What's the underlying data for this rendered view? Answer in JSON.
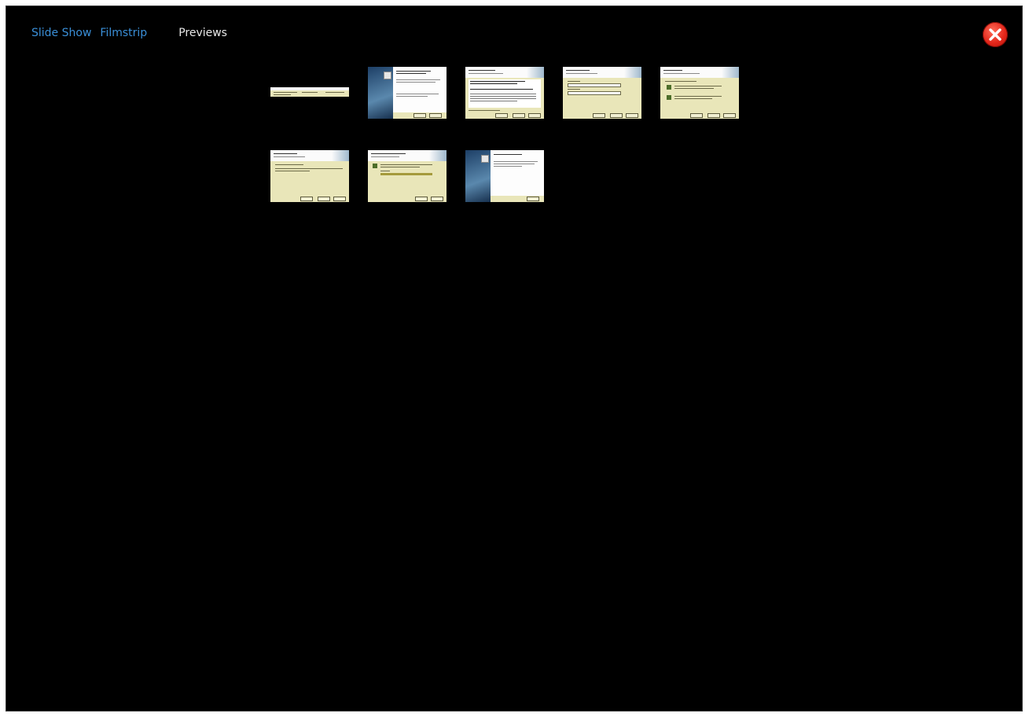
{
  "nav": {
    "items": [
      {
        "label": "Slide Show",
        "state": "link"
      },
      {
        "label": "Filmstrip",
        "state": "link"
      },
      {
        "label": "Previews",
        "state": "active"
      }
    ]
  },
  "close": {
    "icon": "close-icon"
  },
  "colors": {
    "background": "#000000",
    "link": "#3a8fd8",
    "active": "#e8e8e8",
    "close": "#e3261a",
    "thumb_bg": "#e9e6b9"
  },
  "thumbnails": [
    {
      "kind": "strip"
    },
    {
      "kind": "welcome"
    },
    {
      "kind": "license"
    },
    {
      "kind": "form"
    },
    {
      "kind": "options"
    },
    {
      "kind": "ready"
    },
    {
      "kind": "progress"
    },
    {
      "kind": "complete"
    }
  ]
}
